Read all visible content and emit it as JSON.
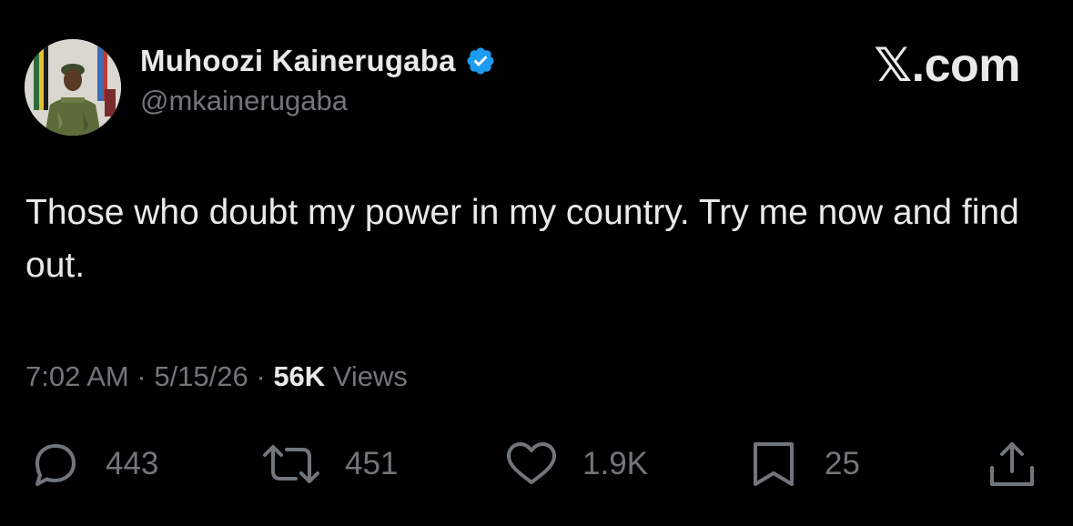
{
  "author": {
    "display_name": "Muhoozi Kainerugaba",
    "handle": "@mkainerugaba",
    "verified": true,
    "avatar_icon": "profile-photo"
  },
  "brand": "𝕏.com",
  "tweet": {
    "text": "Those who doubt my power in my country. Try me now and find out."
  },
  "meta": {
    "time": "7:02 AM",
    "sep1": " · ",
    "date": "5/15/26",
    "sep2": " · ",
    "views_count": "56K",
    "views_label": " Views"
  },
  "actions": {
    "replies": {
      "icon": "reply-icon",
      "count": "443"
    },
    "reposts": {
      "icon": "repost-icon",
      "count": "451"
    },
    "likes": {
      "icon": "heart-icon",
      "count": "1.9K"
    },
    "bookmarks": {
      "icon": "bookmark-icon",
      "count": "25"
    },
    "share": {
      "icon": "share-icon"
    }
  },
  "colors": {
    "background": "#000000",
    "primary_text": "#e7e9ea",
    "secondary_text": "#71767b",
    "verified_blue": "#1d9bf0"
  }
}
